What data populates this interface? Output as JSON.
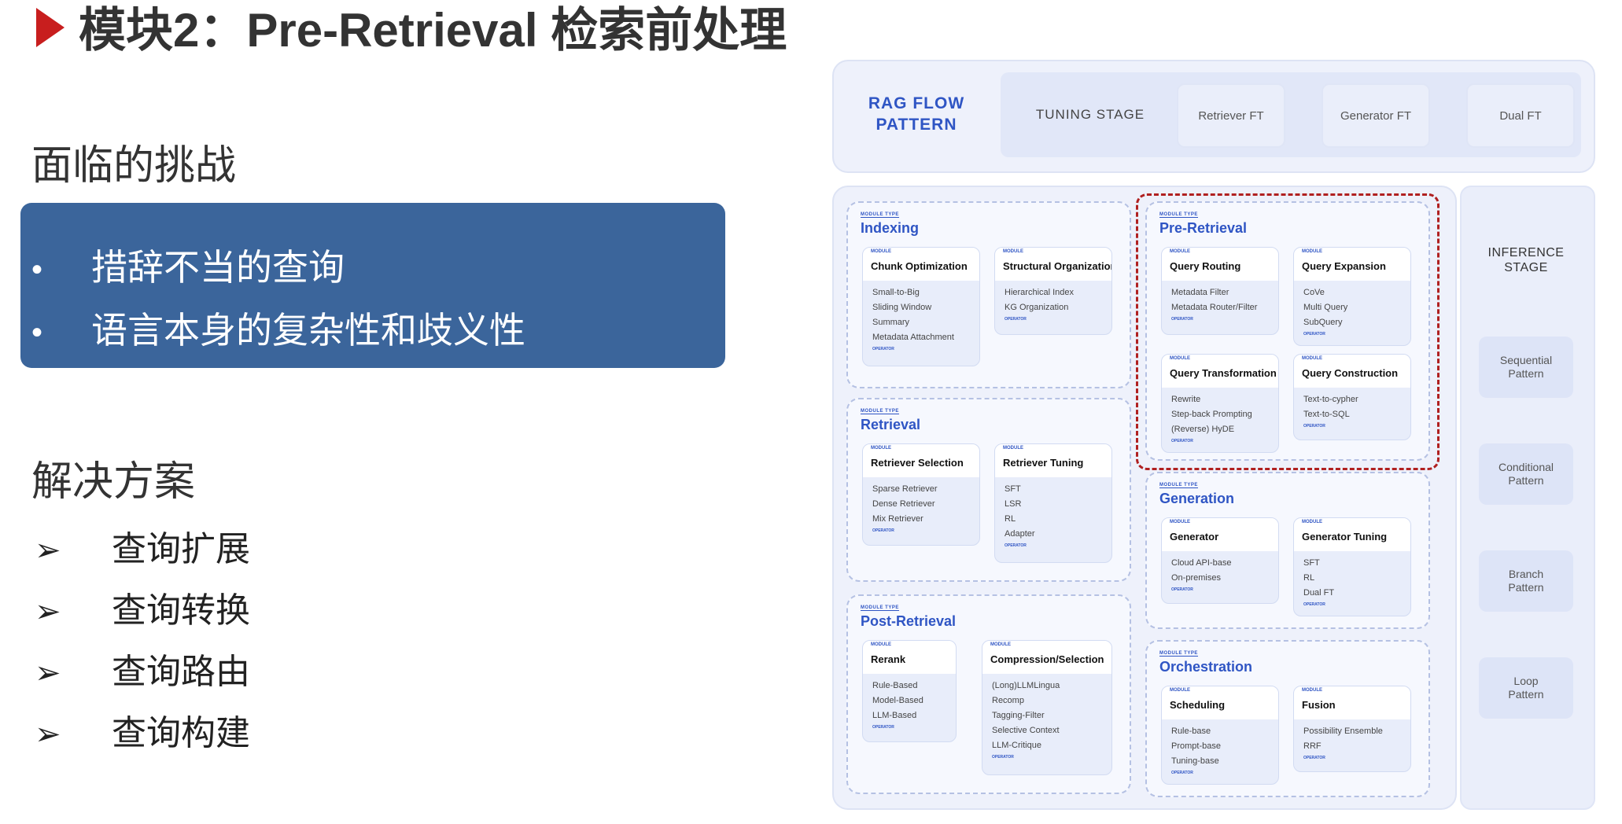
{
  "title": "模块2：Pre-Retrieval 检索前处理",
  "challenges": {
    "heading": "面临的挑战",
    "items": [
      "措辞不当的查询",
      "语言本身的复杂性和歧义性"
    ]
  },
  "solutions": {
    "heading": "解决方案",
    "items": [
      "查询扩展",
      "查询转换",
      "查询路由",
      "查询构建"
    ]
  },
  "diagram": {
    "header": {
      "line1": "RAG FLOW",
      "line2": "PATTERN"
    },
    "tuning_stage": "TUNING STAGE",
    "ft_buttons": [
      "Retriever FT",
      "Generator FT",
      "Dual FT"
    ],
    "module_type_label": "MODULE TYPE",
    "module_label": "MODULE",
    "operator_label": "OPERATOR",
    "groups": {
      "indexing": {
        "title": "Indexing",
        "cards": [
          {
            "title": "Chunk Optimization",
            "items": [
              "Small-to-Big",
              "Sliding Window",
              "Summary",
              "Metadata Attachment"
            ]
          },
          {
            "title": "Structural Organization",
            "items": [
              "Hierarchical Index",
              "KG Organization"
            ]
          }
        ]
      },
      "retrieval": {
        "title": "Retrieval",
        "cards": [
          {
            "title": "Retriever Selection",
            "items": [
              "Sparse Retriever",
              "Dense Retriever",
              "Mix Retriever"
            ]
          },
          {
            "title": "Retriever Tuning",
            "items": [
              "SFT",
              "LSR",
              "RL",
              "Adapter"
            ]
          }
        ]
      },
      "post": {
        "title": "Post-Retrieval",
        "cards": [
          {
            "title": "Rerank",
            "items": [
              "Rule-Based",
              "Model-Based",
              "LLM-Based"
            ]
          },
          {
            "title": "Compression/Selection",
            "items": [
              "(Long)LLMLingua",
              "Recomp",
              "Tagging-Filter",
              "Selective Context",
              "LLM-Critique"
            ]
          }
        ]
      },
      "pre": {
        "title": "Pre-Retrieval",
        "cards": [
          {
            "title": "Query Routing",
            "items": [
              "Metadata Filter",
              "Metadata Router/Filter"
            ]
          },
          {
            "title": "Query Expansion",
            "items": [
              "CoVe",
              "Multi Query",
              "SubQuery"
            ]
          },
          {
            "title": "Query Transformation",
            "items": [
              "Rewrite",
              "Step-back Prompting",
              "(Reverse) HyDE"
            ]
          },
          {
            "title": "Query Construction",
            "items": [
              "Text-to-cypher",
              "Text-to-SQL"
            ]
          }
        ]
      },
      "generation": {
        "title": "Generation",
        "cards": [
          {
            "title": "Generator",
            "items": [
              "Cloud API-base",
              "On-premises"
            ]
          },
          {
            "title": "Generator Tuning",
            "items": [
              "SFT",
              "RL",
              "Dual FT"
            ]
          }
        ]
      },
      "orchestration": {
        "title": "Orchestration",
        "cards": [
          {
            "title": "Scheduling",
            "items": [
              "Rule-base",
              "Prompt-base",
              "Tuning-base"
            ]
          },
          {
            "title": "Fusion",
            "items": [
              "Possibility Ensemble",
              "RRF"
            ]
          }
        ]
      }
    },
    "inference": {
      "label_line1": "INFERENCE",
      "label_line2": "STAGE",
      "patterns": [
        {
          "line1": "Sequential",
          "line2": "Pattern"
        },
        {
          "line1": "Conditional",
          "line2": "Pattern"
        },
        {
          "line1": "Branch",
          "line2": "Pattern"
        },
        {
          "line1": "Loop",
          "line2": "Pattern"
        }
      ]
    }
  },
  "colors": {
    "accent_red": "#c81e1e",
    "blue_box": "#3b659b",
    "diagram_blue": "#2f55c4",
    "highlight_dash": "#b02020"
  }
}
